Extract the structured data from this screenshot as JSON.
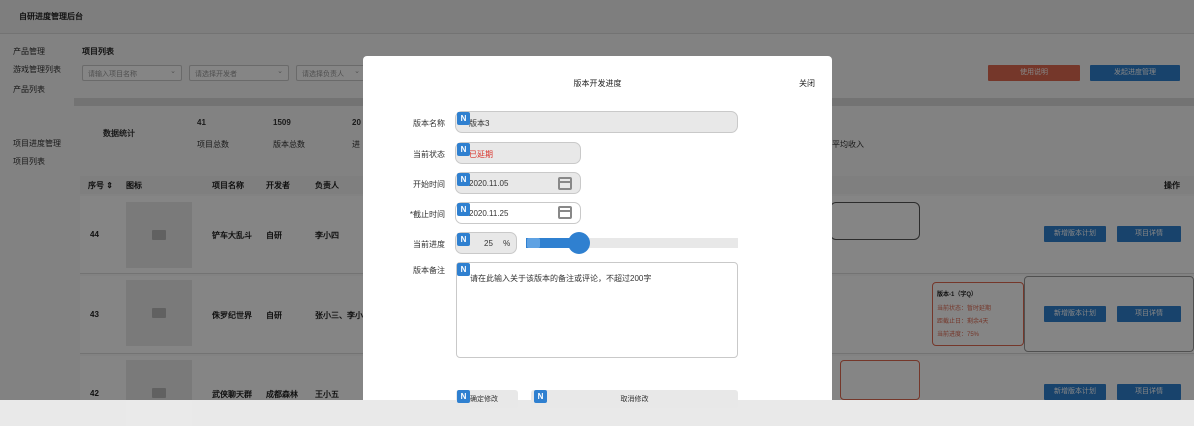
{
  "app": {
    "title": "自研进度管理后台"
  },
  "sidebar": {
    "groups": [
      {
        "label": "产品管理"
      },
      {
        "label": "游戏管理列表"
      },
      {
        "label": "产品列表"
      },
      {
        "label": "项目进度管理"
      },
      {
        "label": "项目列表"
      }
    ]
  },
  "page": {
    "section_title": "项目列表",
    "filters": {
      "project_name_placeholder": "请输入项目名称",
      "developer_placeholder": "请选择开发者",
      "owner_placeholder": "请选择负责人"
    },
    "buttons": {
      "usage": "使用说明",
      "start_progress": "发起进度管理"
    },
    "stats": {
      "label": "数据统计",
      "project_total_value": "41",
      "project_total_label": "项目总数",
      "version_total_value": "1509",
      "version_total_label": "版本总数",
      "partial_value": "20",
      "partial_label": "进",
      "avg_income_label": "平均收入"
    },
    "table": {
      "headers": [
        "序号 ⇕",
        "图标",
        "项目名称",
        "开发者",
        "负责人",
        "操作"
      ],
      "rows": [
        {
          "id": "44",
          "name": "铲车大乱斗",
          "developer": "自研",
          "owner": "李小四",
          "action1": "新增版本计划",
          "action2": "项目详情"
        },
        {
          "id": "43",
          "name": "侏罗纪世界",
          "developer": "自研",
          "owner": "张小三、李小",
          "action1": "新增版本计划",
          "action2": "项目详情"
        },
        {
          "id": "42",
          "name": "武侠聊天群",
          "developer": "成都森林",
          "owner": "王小五",
          "action1": "新增版本计划",
          "action2": "项目详情"
        }
      ],
      "version_card": {
        "title": "版本-1（字Q）",
        "status": "当前状态：暂时延期",
        "deadline": "距截止日：剩余4天",
        "progress": "当前进度：75%"
      }
    }
  },
  "modal": {
    "title": "版本开发进度",
    "close": "关闭",
    "badge": "N",
    "fields": {
      "name_label": "版本名称",
      "name_value": "版本3",
      "status_label": "当前状态",
      "status_value": "已延期",
      "start_label": "开始时间",
      "start_value": "2020.11.05",
      "end_label": "*截止时间",
      "end_value": "2020.11.25",
      "progress_label": "当前进度",
      "progress_value": "25",
      "progress_unit": "%",
      "note_label": "版本备注",
      "note_placeholder": "请在此输入关于该版本的备注或评论，不超过200字"
    },
    "progress_fraction": 0.25,
    "footer": {
      "confirm": "确定修改",
      "cancel": "取消修改"
    },
    "colors": {
      "accent": "#2f80d0",
      "status_red": "#d9342b"
    }
  }
}
